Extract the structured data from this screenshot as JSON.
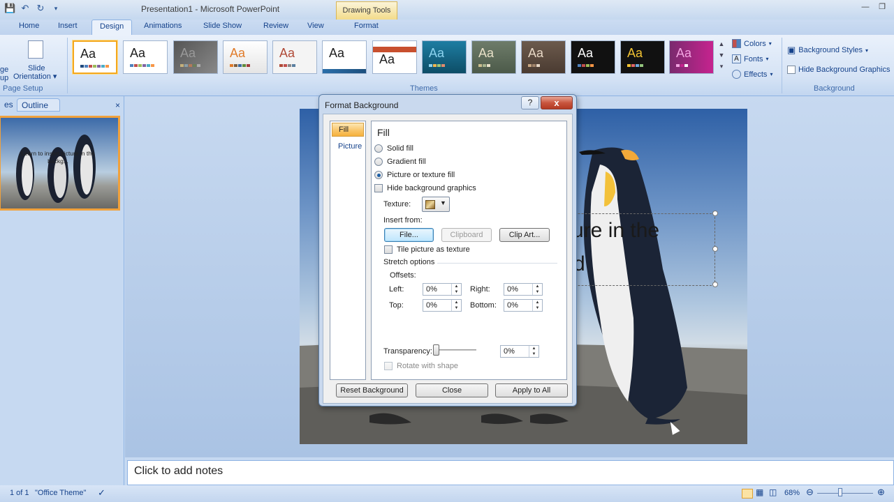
{
  "titlebar": {
    "title": "Presentation1 - Microsoft PowerPoint",
    "contextual_group": "Drawing Tools"
  },
  "tabs": [
    "Home",
    "Insert",
    "Design",
    "Animations",
    "Slide Show",
    "Review",
    "View",
    "Format"
  ],
  "active_tab": "Design",
  "ribbon": {
    "page_setup": {
      "label_partial_1": "ge",
      "label_partial_2": "up",
      "orientation_line1": "Slide",
      "orientation_line2": "Orientation",
      "group": "Page Setup"
    },
    "themes": {
      "group": "Themes",
      "tile_text": "Aa"
    },
    "theme_cmds": {
      "colors": "Colors",
      "fonts": "Fonts",
      "effects": "Effects"
    },
    "background": {
      "styles": "Background Styles",
      "hide": "Hide Background Graphics",
      "group": "Background"
    }
  },
  "left_pane": {
    "tab_slides_partial": "es",
    "tab_outline": "Outline",
    "close": "×",
    "thumb_text": "Learn to insert picture in the backg..."
  },
  "slide": {
    "visible_title": "ure in the",
    "visible_line2": "d"
  },
  "notes": {
    "placeholder": "Click to add notes"
  },
  "statusbar": {
    "slide_info": "1 of 1",
    "theme": "\"Office Theme\"",
    "zoom": "68%"
  },
  "dialog": {
    "title": "Format Background",
    "help": "?",
    "close": "x",
    "categories": [
      "Fill",
      "Picture"
    ],
    "selected_category": "Fill",
    "heading": "Fill",
    "options": {
      "solid": "Solid fill",
      "gradient": "Gradient fill",
      "picture": "Picture or texture fill",
      "hide_bg": "Hide background graphics"
    },
    "selected_option": "picture",
    "texture_label": "Texture:",
    "insert_from": "Insert from:",
    "file_btn": "File...",
    "clipboard_btn": "Clipboard",
    "clipart_btn": "Clip Art...",
    "tile": "Tile picture as texture",
    "stretch": "Stretch options",
    "offsets": "Offsets:",
    "left_label": "Left:",
    "left_value": "0%",
    "right_label": "Right:",
    "right_value": "0%",
    "top_label": "Top:",
    "top_value": "0%",
    "bottom_label": "Bottom:",
    "bottom_value": "0%",
    "transparency_label": "Transparency:",
    "transparency_value": "0%",
    "transparency_level": 0,
    "rotate": "Rotate with shape",
    "reset_btn": "Reset Background",
    "close_btn": "Close",
    "apply_all_btn": "Apply to All"
  }
}
